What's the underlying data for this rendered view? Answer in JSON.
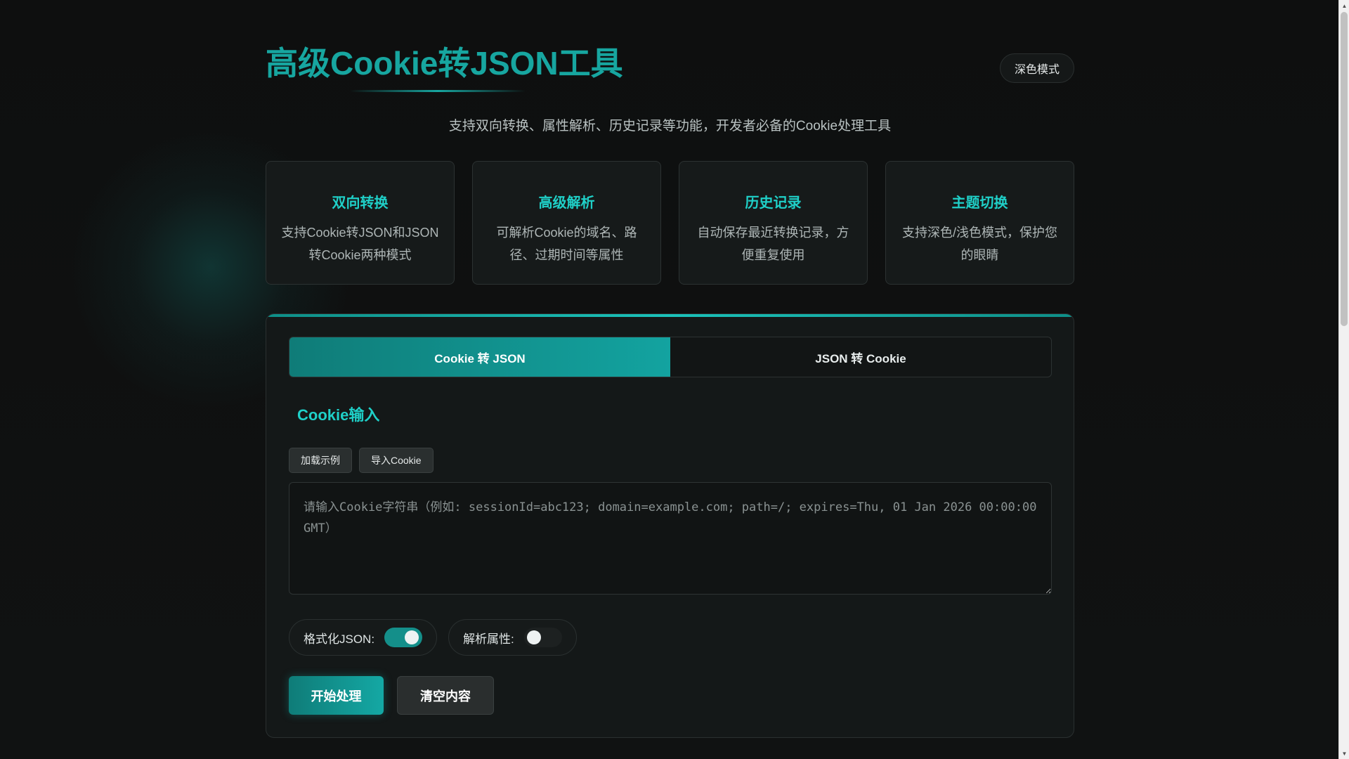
{
  "header": {
    "title": "高级Cookie转JSON工具",
    "theme_toggle_label": "深色模式",
    "subtitle": "支持双向转换、属性解析、历史记录等功能，开发者必备的Cookie处理工具"
  },
  "features": [
    {
      "title": "双向转换",
      "desc": "支持Cookie转JSON和JSON转Cookie两种模式"
    },
    {
      "title": "高级解析",
      "desc": "可解析Cookie的域名、路径、过期时间等属性"
    },
    {
      "title": "历史记录",
      "desc": "自动保存最近转换记录，方便重复使用"
    },
    {
      "title": "主题切换",
      "desc": "支持深色/浅色模式，保护您的眼睛"
    }
  ],
  "tabs": [
    {
      "label": "Cookie 转 JSON",
      "active": true
    },
    {
      "label": "JSON 转 Cookie",
      "active": false
    }
  ],
  "input_section": {
    "title": "Cookie输入",
    "load_example_label": "加载示例",
    "import_label": "导入Cookie",
    "value": "",
    "placeholder": "请输入Cookie字符串（例如: sessionId=abc123; domain=example.com; path=/; expires=Thu, 01 Jan 2026 00:00:00 GMT）"
  },
  "options": {
    "format_json_label": "格式化JSON:",
    "format_json_on": true,
    "parse_attrs_label": "解析属性:",
    "parse_attrs_on": false
  },
  "actions": {
    "start_label": "开始处理",
    "clear_label": "清空内容"
  },
  "colors": {
    "accent": "#1fd0c8",
    "accent_dark": "#0f7c78",
    "background": "#0d0f0f",
    "card": "#161a1a"
  }
}
